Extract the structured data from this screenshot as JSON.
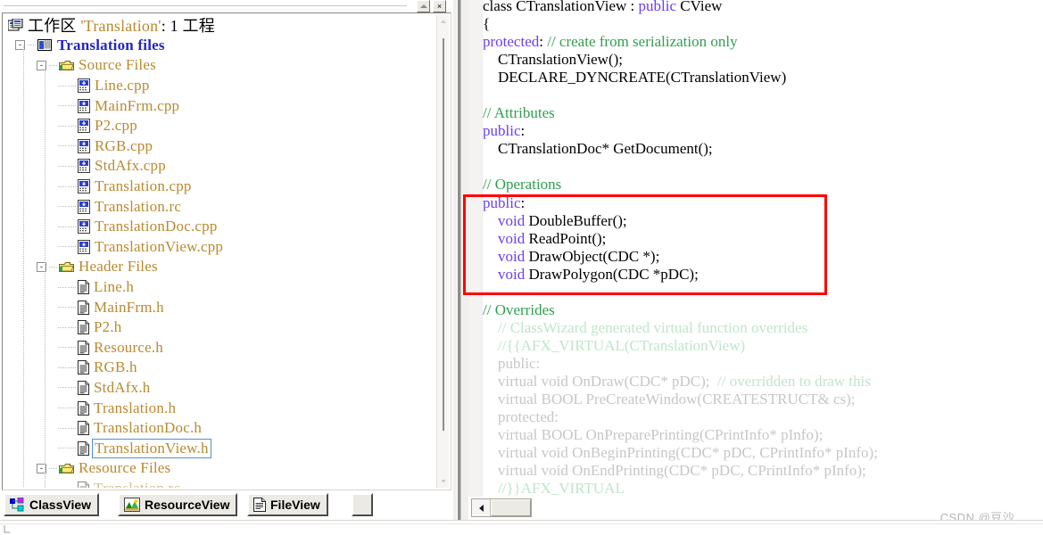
{
  "window": {
    "restore_label": "restore-window",
    "close_label": "×"
  },
  "workspace": {
    "root_prefix": "工作区 ",
    "root_project": "'Translation'",
    "root_suffix": ": 1 工程",
    "project_node": "Translation files",
    "expander_open": "-",
    "folders": [
      {
        "name": "Source Files",
        "icon": "folder-open-icon",
        "files": [
          {
            "name": "Line.cpp",
            "icon": "cpp-file-icon"
          },
          {
            "name": "MainFrm.cpp",
            "icon": "cpp-file-icon"
          },
          {
            "name": "P2.cpp",
            "icon": "cpp-file-icon"
          },
          {
            "name": "RGB.cpp",
            "icon": "cpp-file-icon"
          },
          {
            "name": "StdAfx.cpp",
            "icon": "cpp-file-icon"
          },
          {
            "name": "Translation.cpp",
            "icon": "cpp-file-icon"
          },
          {
            "name": "Translation.rc",
            "icon": "cpp-file-icon"
          },
          {
            "name": "TranslationDoc.cpp",
            "icon": "cpp-file-icon"
          },
          {
            "name": "TranslationView.cpp",
            "icon": "cpp-file-icon"
          }
        ]
      },
      {
        "name": "Header Files",
        "icon": "folder-open-icon",
        "files": [
          {
            "name": "Line.h",
            "icon": "header-file-icon"
          },
          {
            "name": "MainFrm.h",
            "icon": "header-file-icon"
          },
          {
            "name": "P2.h",
            "icon": "header-file-icon"
          },
          {
            "name": "Resource.h",
            "icon": "header-file-icon"
          },
          {
            "name": "RGB.h",
            "icon": "header-file-icon"
          },
          {
            "name": "StdAfx.h",
            "icon": "header-file-icon"
          },
          {
            "name": "Translation.h",
            "icon": "header-file-icon"
          },
          {
            "name": "TranslationDoc.h",
            "icon": "header-file-icon"
          },
          {
            "name": "TranslationView.h",
            "icon": "header-file-icon",
            "selected": true
          }
        ]
      },
      {
        "name": "Resource Files",
        "icon": "folder-open-icon",
        "files": []
      }
    ]
  },
  "tabs": [
    {
      "id": "classview",
      "label": "ClassView",
      "icon": "class-view-icon",
      "active": false
    },
    {
      "id": "resourceview",
      "label": "ResourceView",
      "icon": "resource-view-icon",
      "active": false
    },
    {
      "id": "fileview",
      "label": "FileView",
      "icon": "file-view-icon",
      "active": true
    }
  ],
  "editor": {
    "lines": [
      [
        {
          "t": "class ",
          "c": "pl"
        },
        {
          "t": "CTranslationView ",
          "c": "pl"
        },
        {
          "t": ": ",
          "c": "pl"
        },
        {
          "t": "public",
          "c": "kw"
        },
        {
          "t": " CView",
          "c": "pl"
        }
      ],
      [
        {
          "t": "{",
          "c": "pl"
        }
      ],
      [
        {
          "t": "protected",
          "c": "kw"
        },
        {
          "t": ": ",
          "c": "pl"
        },
        {
          "t": "// create from serialization only",
          "c": "cm"
        }
      ],
      [
        {
          "t": "    CTranslationView();",
          "c": "pl"
        }
      ],
      [
        {
          "t": "    DECLARE_DYNCREATE(CTranslationView)",
          "c": "pl"
        }
      ],
      [
        {
          "t": "",
          "c": "pl"
        }
      ],
      [
        {
          "t": "// Attributes",
          "c": "cm"
        }
      ],
      [
        {
          "t": "public",
          "c": "kw"
        },
        {
          "t": ":",
          "c": "pl"
        }
      ],
      [
        {
          "t": "    CTranslationDoc* GetDocument();",
          "c": "pl"
        }
      ],
      [
        {
          "t": "",
          "c": "pl"
        }
      ],
      [
        {
          "t": "// Operations",
          "c": "cm"
        }
      ],
      [
        {
          "t": "public",
          "c": "kw"
        },
        {
          "t": ":",
          "c": "pl"
        }
      ],
      [
        {
          "t": "    ",
          "c": "pl"
        },
        {
          "t": "void",
          "c": "kw"
        },
        {
          "t": " DoubleBuffer();",
          "c": "pl"
        }
      ],
      [
        {
          "t": "    ",
          "c": "pl"
        },
        {
          "t": "void",
          "c": "kw"
        },
        {
          "t": " ReadPoint();",
          "c": "pl"
        }
      ],
      [
        {
          "t": "    ",
          "c": "pl"
        },
        {
          "t": "void",
          "c": "kw"
        },
        {
          "t": " DrawObject(CDC *);",
          "c": "pl"
        }
      ],
      [
        {
          "t": "    ",
          "c": "pl"
        },
        {
          "t": "void",
          "c": "kw"
        },
        {
          "t": " DrawPolygon(CDC *pDC);",
          "c": "pl"
        }
      ],
      [
        {
          "t": "",
          "c": "pl"
        }
      ],
      [
        {
          "t": "// Overrides",
          "c": "cm"
        }
      ],
      [
        {
          "t": "    ",
          "c": "pl"
        },
        {
          "t": "// ClassWizard generated virtual function overrides",
          "c": "dimcm"
        }
      ],
      [
        {
          "t": "    ",
          "c": "pl"
        },
        {
          "t": "//{{AFX_VIRTUAL(CTranslationView)",
          "c": "dimcm"
        }
      ],
      [
        {
          "t": "    ",
          "c": "pl"
        },
        {
          "t": "public:",
          "c": "dim"
        }
      ],
      [
        {
          "t": "    ",
          "c": "pl"
        },
        {
          "t": "virtual void OnDraw(CDC* pDC);  ",
          "c": "dim"
        },
        {
          "t": "// overridden to draw this",
          "c": "dimcm"
        }
      ],
      [
        {
          "t": "    ",
          "c": "pl"
        },
        {
          "t": "virtual BOOL PreCreateWindow(CREATESTRUCT& cs);",
          "c": "dim"
        }
      ],
      [
        {
          "t": "    ",
          "c": "pl"
        },
        {
          "t": "protected:",
          "c": "dim"
        }
      ],
      [
        {
          "t": "    ",
          "c": "pl"
        },
        {
          "t": "virtual BOOL OnPreparePrinting(CPrintInfo* pInfo);",
          "c": "dim"
        }
      ],
      [
        {
          "t": "    ",
          "c": "pl"
        },
        {
          "t": "virtual void OnBeginPrinting(CDC* pDC, CPrintInfo* pInfo);",
          "c": "dim"
        }
      ],
      [
        {
          "t": "    ",
          "c": "pl"
        },
        {
          "t": "virtual void OnEndPrinting(CDC* pDC, CPrintInfo* pInfo);",
          "c": "dim"
        }
      ],
      [
        {
          "t": "    ",
          "c": "pl"
        },
        {
          "t": "//}}AFX_VIRTUAL",
          "c": "dimcm"
        }
      ]
    ],
    "highlight_box_color": "#ff0000"
  },
  "watermark": "CSDN @豆沙_",
  "colors": {
    "keyword": "#6a3df5",
    "comment": "#2f9e4f",
    "tree_label": "#b98a30",
    "project_node": "#2424c8",
    "selection_border": "#4a90d9",
    "highlight": "#ff0000"
  }
}
